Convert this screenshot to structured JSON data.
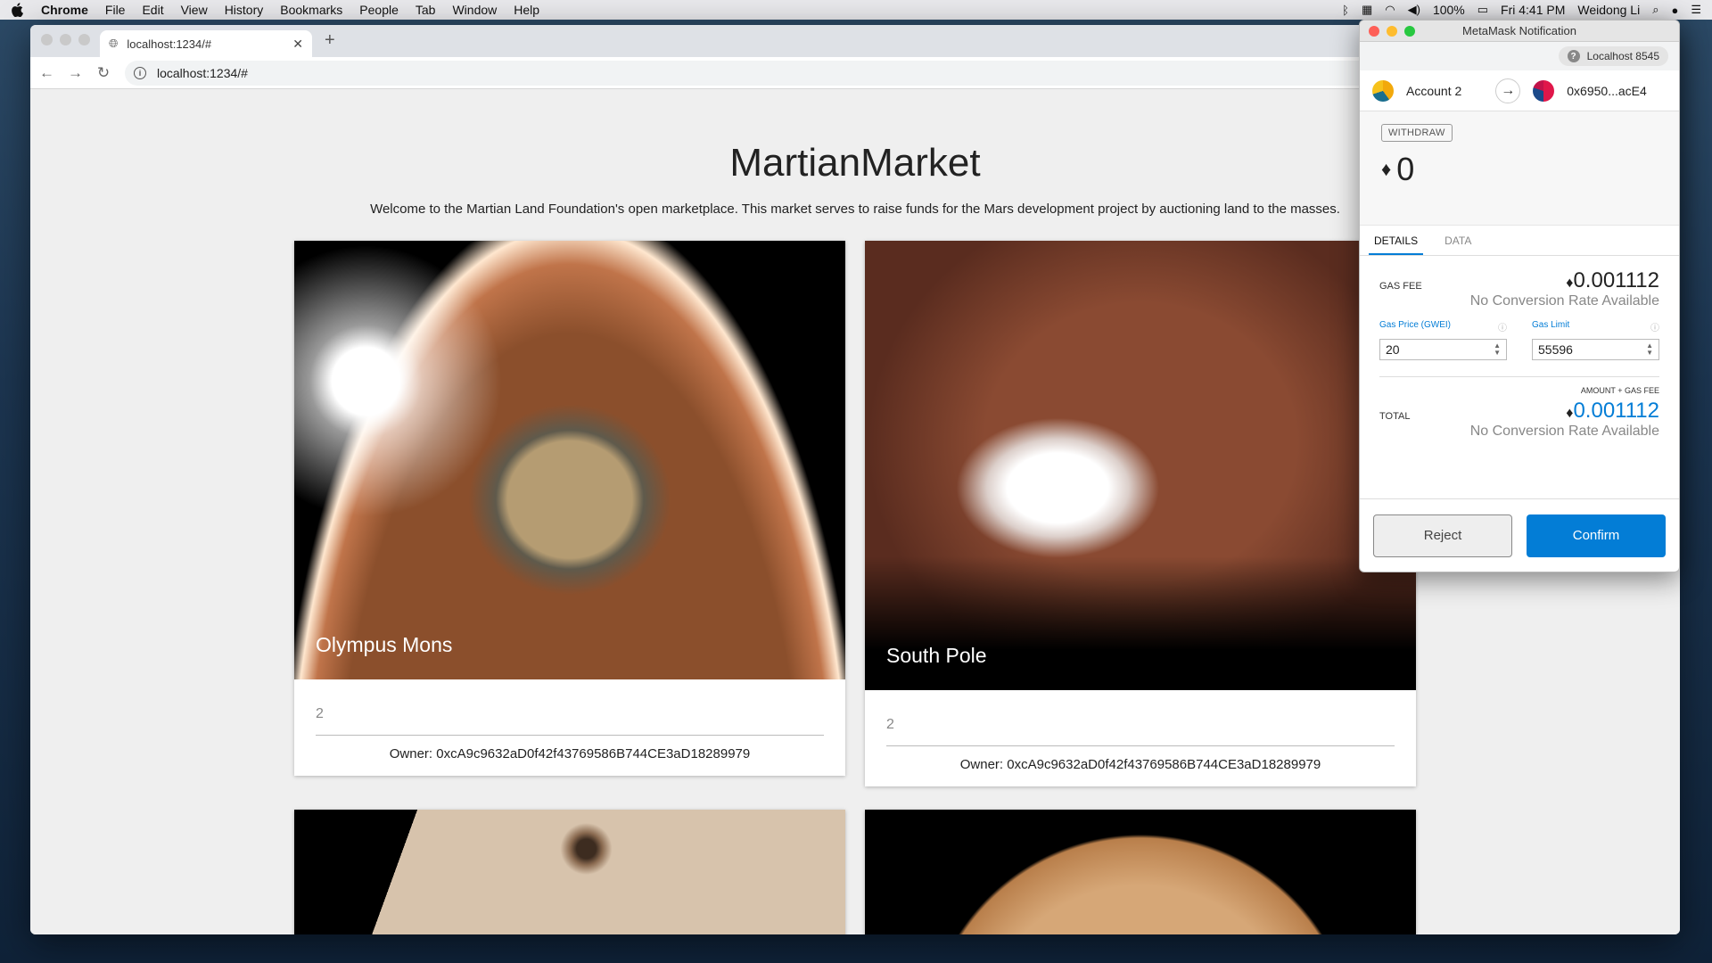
{
  "menubar": {
    "app": "Chrome",
    "items": [
      "File",
      "Edit",
      "View",
      "History",
      "Bookmarks",
      "People",
      "Tab",
      "Window",
      "Help"
    ],
    "battery": "100%",
    "clock": "Fri 4:41 PM",
    "user": "Weidong Li"
  },
  "browser": {
    "tab_title": "localhost:1234/#",
    "url": "localhost:1234/#"
  },
  "page": {
    "title": "MartianMarket",
    "subtitle": "Welcome to the Martian Land Foundation's open marketplace. This market serves to raise funds for the Mars development project by auctioning land to the masses.",
    "cards": [
      {
        "name": "Olympus Mons",
        "price": "2",
        "owner": "Owner: 0xcA9c9632aD0f42f43769586B744CE3aD18289979"
      },
      {
        "name": "South Pole",
        "price": "2",
        "owner": "Owner: 0xcA9c9632aD0f42f43769586B744CE3aD18289979"
      }
    ]
  },
  "metamask": {
    "window_title": "MetaMask Notification",
    "network": "Localhost 8545",
    "from_account": "Account 2",
    "to_address": "0x6950...acE4",
    "action_badge": "WITHDRAW",
    "amount": "0",
    "tabs": [
      "DETAILS",
      "DATA"
    ],
    "gas_fee_label": "GAS FEE",
    "gas_fee_value": "0.001112",
    "no_conversion": "No Conversion Rate Available",
    "gas_price_label": "Gas Price (GWEI)",
    "gas_price_value": "20",
    "gas_limit_label": "Gas Limit",
    "gas_limit_value": "55596",
    "amount_gas_note": "AMOUNT + GAS FEE",
    "total_label": "TOTAL",
    "total_value": "0.001112",
    "reject_label": "Reject",
    "confirm_label": "Confirm",
    "accent_color": "#037dd6"
  }
}
